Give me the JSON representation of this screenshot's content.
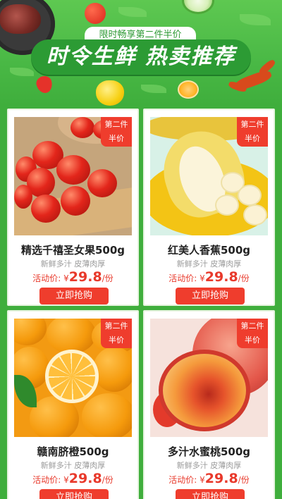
{
  "banner": {
    "promo": "限时畅享第二件半价",
    "title": "时令生鲜  热卖推荐"
  },
  "products": [
    {
      "name": "精选千禧圣女果500g",
      "desc": "新鲜多汁 皮薄肉厚",
      "price_label": "活动价: ",
      "currency": "¥",
      "price": "29.8",
      "unit": "/份",
      "badge_line1": "第二件",
      "badge_line2": "半价",
      "button": "立即抢购"
    },
    {
      "name": "红美人香蕉500g",
      "desc": "新鲜多汁 皮薄肉厚",
      "price_label": "活动价: ",
      "currency": "¥",
      "price": "29.8",
      "unit": "/份",
      "badge_line1": "第二件",
      "badge_line2": "半价",
      "button": "立即抢购"
    },
    {
      "name": "赣南脐橙500g",
      "desc": "新鲜多汁 皮薄肉厚",
      "price_label": "活动价: ",
      "currency": "¥",
      "price": "29.8",
      "unit": "/份",
      "badge_line1": "第二件",
      "badge_line2": "半价",
      "button": "立即抢购"
    },
    {
      "name": "多汁水蜜桃500g",
      "desc": "新鲜多汁 皮薄肉厚",
      "price_label": "活动价: ",
      "currency": "¥",
      "price": "29.8",
      "unit": "/份",
      "badge_line1": "第二件",
      "badge_line2": "半价",
      "button": "立即抢购"
    }
  ],
  "colors": {
    "background_green": "#3fae3c",
    "title_green": "#2c9b34",
    "accent_red": "#ef3d2d"
  }
}
